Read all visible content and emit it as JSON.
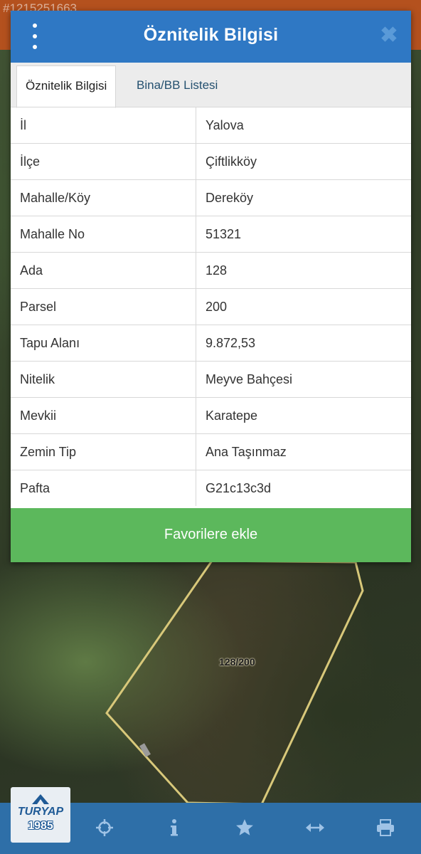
{
  "watermark_id": "#1215251663",
  "dialog": {
    "title": "Öznitelik Bilgisi",
    "close_glyph": "✖",
    "tabs": [
      {
        "label": "Öznitelik Bilgisi",
        "active": true
      },
      {
        "label": "Bina/BB Listesi",
        "active": false
      }
    ],
    "rows": [
      {
        "key": "İl",
        "value": "Yalova"
      },
      {
        "key": "İlçe",
        "value": "Çiftlikköy"
      },
      {
        "key": "Mahalle/Köy",
        "value": "Dereköy"
      },
      {
        "key": "Mahalle No",
        "value": "51321"
      },
      {
        "key": "Ada",
        "value": "128"
      },
      {
        "key": "Parsel",
        "value": "200"
      },
      {
        "key": "Tapu Alanı",
        "value": "9.872,53"
      },
      {
        "key": "Nitelik",
        "value": "Meyve Bahçesi"
      },
      {
        "key": "Mevkii",
        "value": "Karatepe"
      },
      {
        "key": "Zemin Tip",
        "value": "Ana Taşınmaz"
      },
      {
        "key": "Pafta",
        "value": "G21c13c3d"
      }
    ],
    "favorite_button": "Favorilere ekle"
  },
  "map": {
    "parcel_label": "128/200"
  },
  "logo": {
    "line1": "TURYAP",
    "line2": "1985"
  },
  "toolbar": {
    "icons": [
      "crosshair-icon",
      "info-icon",
      "star-icon",
      "arrows-horizontal-icon",
      "printer-icon"
    ]
  },
  "colors": {
    "header": "#2f78c4",
    "favorite_button": "#5cb85c",
    "bottom_bar": "#2e6fa8"
  }
}
